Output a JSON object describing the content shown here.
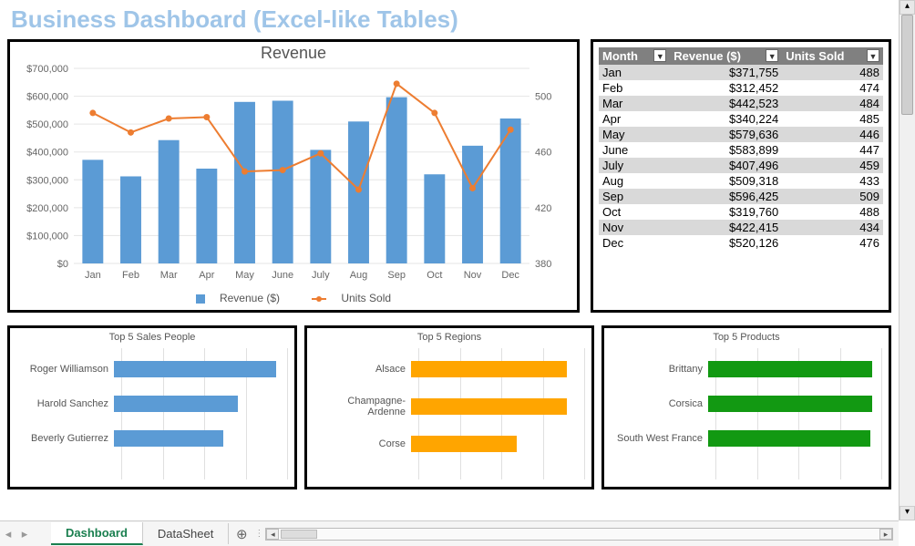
{
  "title": "Business Dashboard (Excel-like Tables)",
  "tabs": {
    "active": "Dashboard",
    "other": "DataSheet"
  },
  "chart_data": [
    {
      "type": "bar+line",
      "title": "Revenue",
      "categories": [
        "Jan",
        "Feb",
        "Mar",
        "Apr",
        "May",
        "June",
        "July",
        "Aug",
        "Sep",
        "Oct",
        "Nov",
        "Dec"
      ],
      "series": [
        {
          "name": "Revenue ($)",
          "kind": "bar",
          "axis": "left",
          "values": [
            371755,
            312452,
            442523,
            340224,
            579636,
            583899,
            407496,
            509318,
            596425,
            319760,
            422415,
            520126
          ]
        },
        {
          "name": "Units Sold",
          "kind": "line",
          "axis": "right",
          "values": [
            488,
            474,
            484,
            485,
            446,
            447,
            459,
            433,
            509,
            488,
            434,
            476
          ]
        }
      ],
      "y_left": {
        "min": 0,
        "max": 700000,
        "ticks": [
          0,
          100000,
          200000,
          300000,
          400000,
          500000,
          600000,
          700000
        ],
        "format": "$#,##0"
      },
      "y_right": {
        "min": 380,
        "max": 520,
        "ticks": [
          380,
          420,
          460,
          500
        ]
      },
      "legend": [
        "Revenue ($)",
        "Units Sold"
      ]
    },
    {
      "type": "hbar",
      "title": "Top 5 Sales People",
      "color": "#5b9bd5",
      "xlim": [
        0,
        100
      ],
      "items": [
        {
          "label": "Roger Williamson",
          "value": 92
        },
        {
          "label": "Harold Sanchez",
          "value": 70
        },
        {
          "label": "Beverly Gutierrez",
          "value": 62
        }
      ]
    },
    {
      "type": "hbar",
      "title": "Top 5 Regions",
      "color": "#ffa500",
      "xlim": [
        0,
        100
      ],
      "items": [
        {
          "label": "Alsace",
          "value": 88
        },
        {
          "label": "Champagne-Ardenne",
          "value": 88
        },
        {
          "label": "Corse",
          "value": 60
        }
      ]
    },
    {
      "type": "hbar",
      "title": "Top 5 Products",
      "color": "#129912",
      "xlim": [
        0,
        100
      ],
      "items": [
        {
          "label": "Brittany",
          "value": 93
        },
        {
          "label": "Corsica",
          "value": 93
        },
        {
          "label": "South West France",
          "value": 92
        }
      ]
    }
  ],
  "table": {
    "columns": [
      "Month",
      "Revenue ($)",
      "Units Sold"
    ],
    "rows": [
      [
        "Jan",
        "$371,755",
        "488"
      ],
      [
        "Feb",
        "$312,452",
        "474"
      ],
      [
        "Mar",
        "$442,523",
        "484"
      ],
      [
        "Apr",
        "$340,224",
        "485"
      ],
      [
        "May",
        "$579,636",
        "446"
      ],
      [
        "June",
        "$583,899",
        "447"
      ],
      [
        "July",
        "$407,496",
        "459"
      ],
      [
        "Aug",
        "$509,318",
        "433"
      ],
      [
        "Sep",
        "$596,425",
        "509"
      ],
      [
        "Oct",
        "$319,760",
        "488"
      ],
      [
        "Nov",
        "$422,415",
        "434"
      ],
      [
        "Dec",
        "$520,126",
        "476"
      ]
    ]
  }
}
